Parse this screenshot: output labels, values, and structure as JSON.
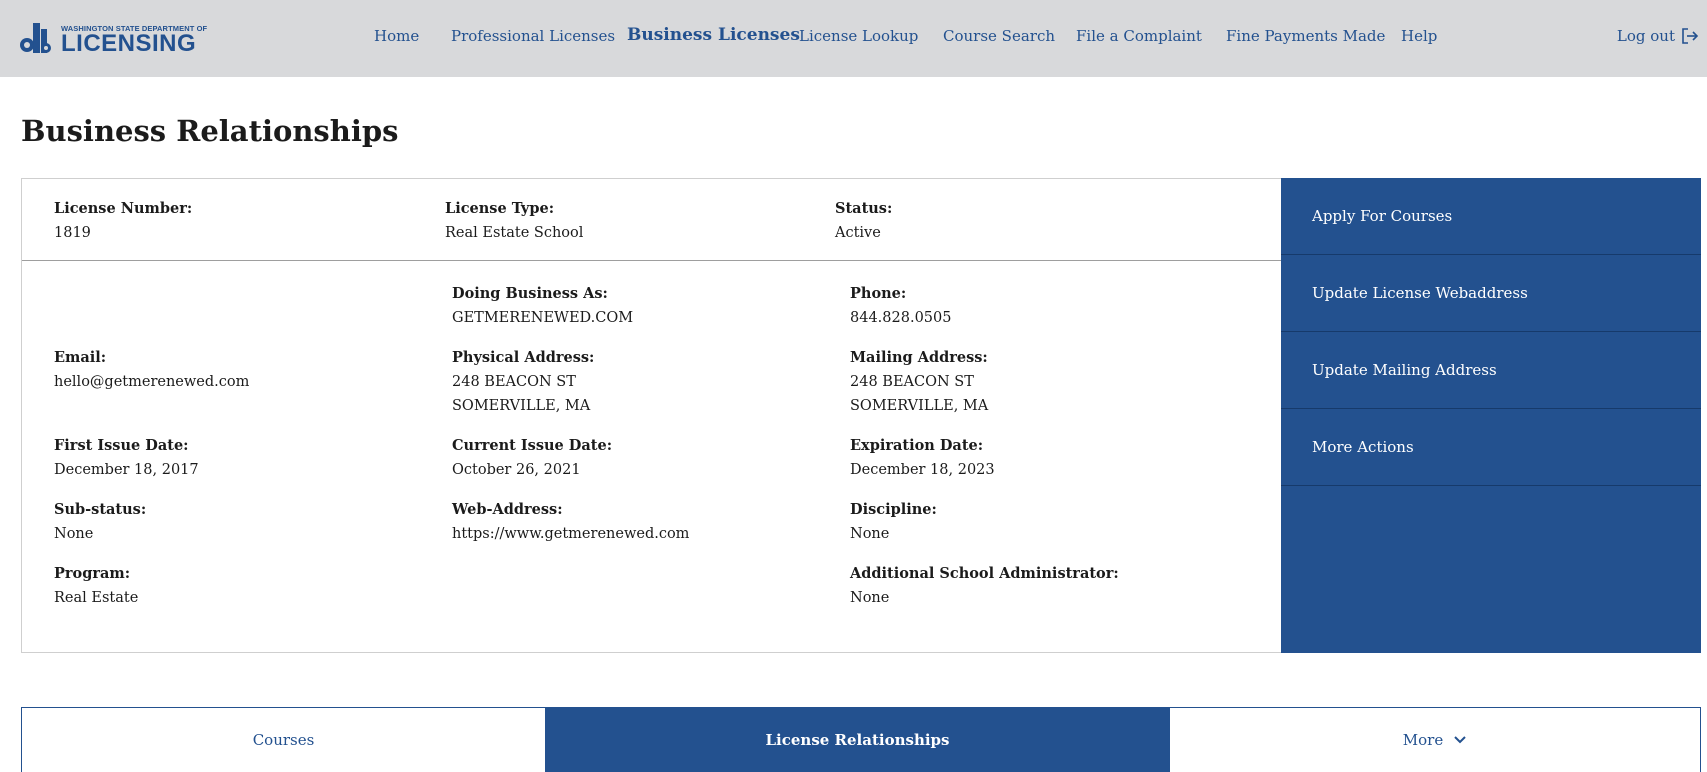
{
  "header": {
    "logo_small": "WASHINGTON STATE DEPARTMENT OF",
    "logo_big": "LICENSING",
    "nav": [
      {
        "label": "Home"
      },
      {
        "label": "Professional Licenses"
      },
      {
        "label": "Business Licenses"
      },
      {
        "label": "License Lookup"
      },
      {
        "label": "Course Search"
      },
      {
        "label": "File a Complaint"
      },
      {
        "label": "Fine Payments Made"
      },
      {
        "label": "Help"
      }
    ],
    "logout": "Log out"
  },
  "page_title": "Business Relationships",
  "summary": {
    "license_number_label": "License Number:",
    "license_number": "1819",
    "license_type_label": "License Type:",
    "license_type": "Real Estate School",
    "status_label": "Status:",
    "status": "Active"
  },
  "details": {
    "dba_label": "Doing Business As:",
    "dba": "GETMERENEWED.COM",
    "phone_label": "Phone:",
    "phone": "844.828.0505",
    "email_label": "Email:",
    "email": "hello@getmerenewed.com",
    "physical_label": "Physical Address:",
    "physical_line1": "248 BEACON ST",
    "physical_line2": "SOMERVILLE, MA",
    "mailing_label": "Mailing Address:",
    "mailing_line1": "248 BEACON ST",
    "mailing_line2": "SOMERVILLE, MA",
    "first_issue_label": "First Issue Date:",
    "first_issue": "December 18, 2017",
    "current_issue_label": "Current Issue Date:",
    "current_issue": "October 26, 2021",
    "expiration_label": "Expiration Date:",
    "expiration": "December 18, 2023",
    "substatus_label": "Sub-status:",
    "substatus": "None",
    "web_label": "Web-Address:",
    "web": "https://www.getmerenewed.com",
    "discipline_label": "Discipline:",
    "discipline": "None",
    "program_label": "Program:",
    "program": "Real Estate",
    "admin_label": "Additional School Administrator:",
    "admin": "None"
  },
  "actions": [
    {
      "label": "Apply For Courses"
    },
    {
      "label": "Update License Webaddress"
    },
    {
      "label": "Update Mailing Address"
    },
    {
      "label": "More Actions"
    }
  ],
  "tabs": [
    {
      "label": "Courses"
    },
    {
      "label": "License Relationships"
    },
    {
      "label": "More"
    }
  ],
  "colors": {
    "brand": "#23518f",
    "header_bg": "#d8d9db"
  }
}
